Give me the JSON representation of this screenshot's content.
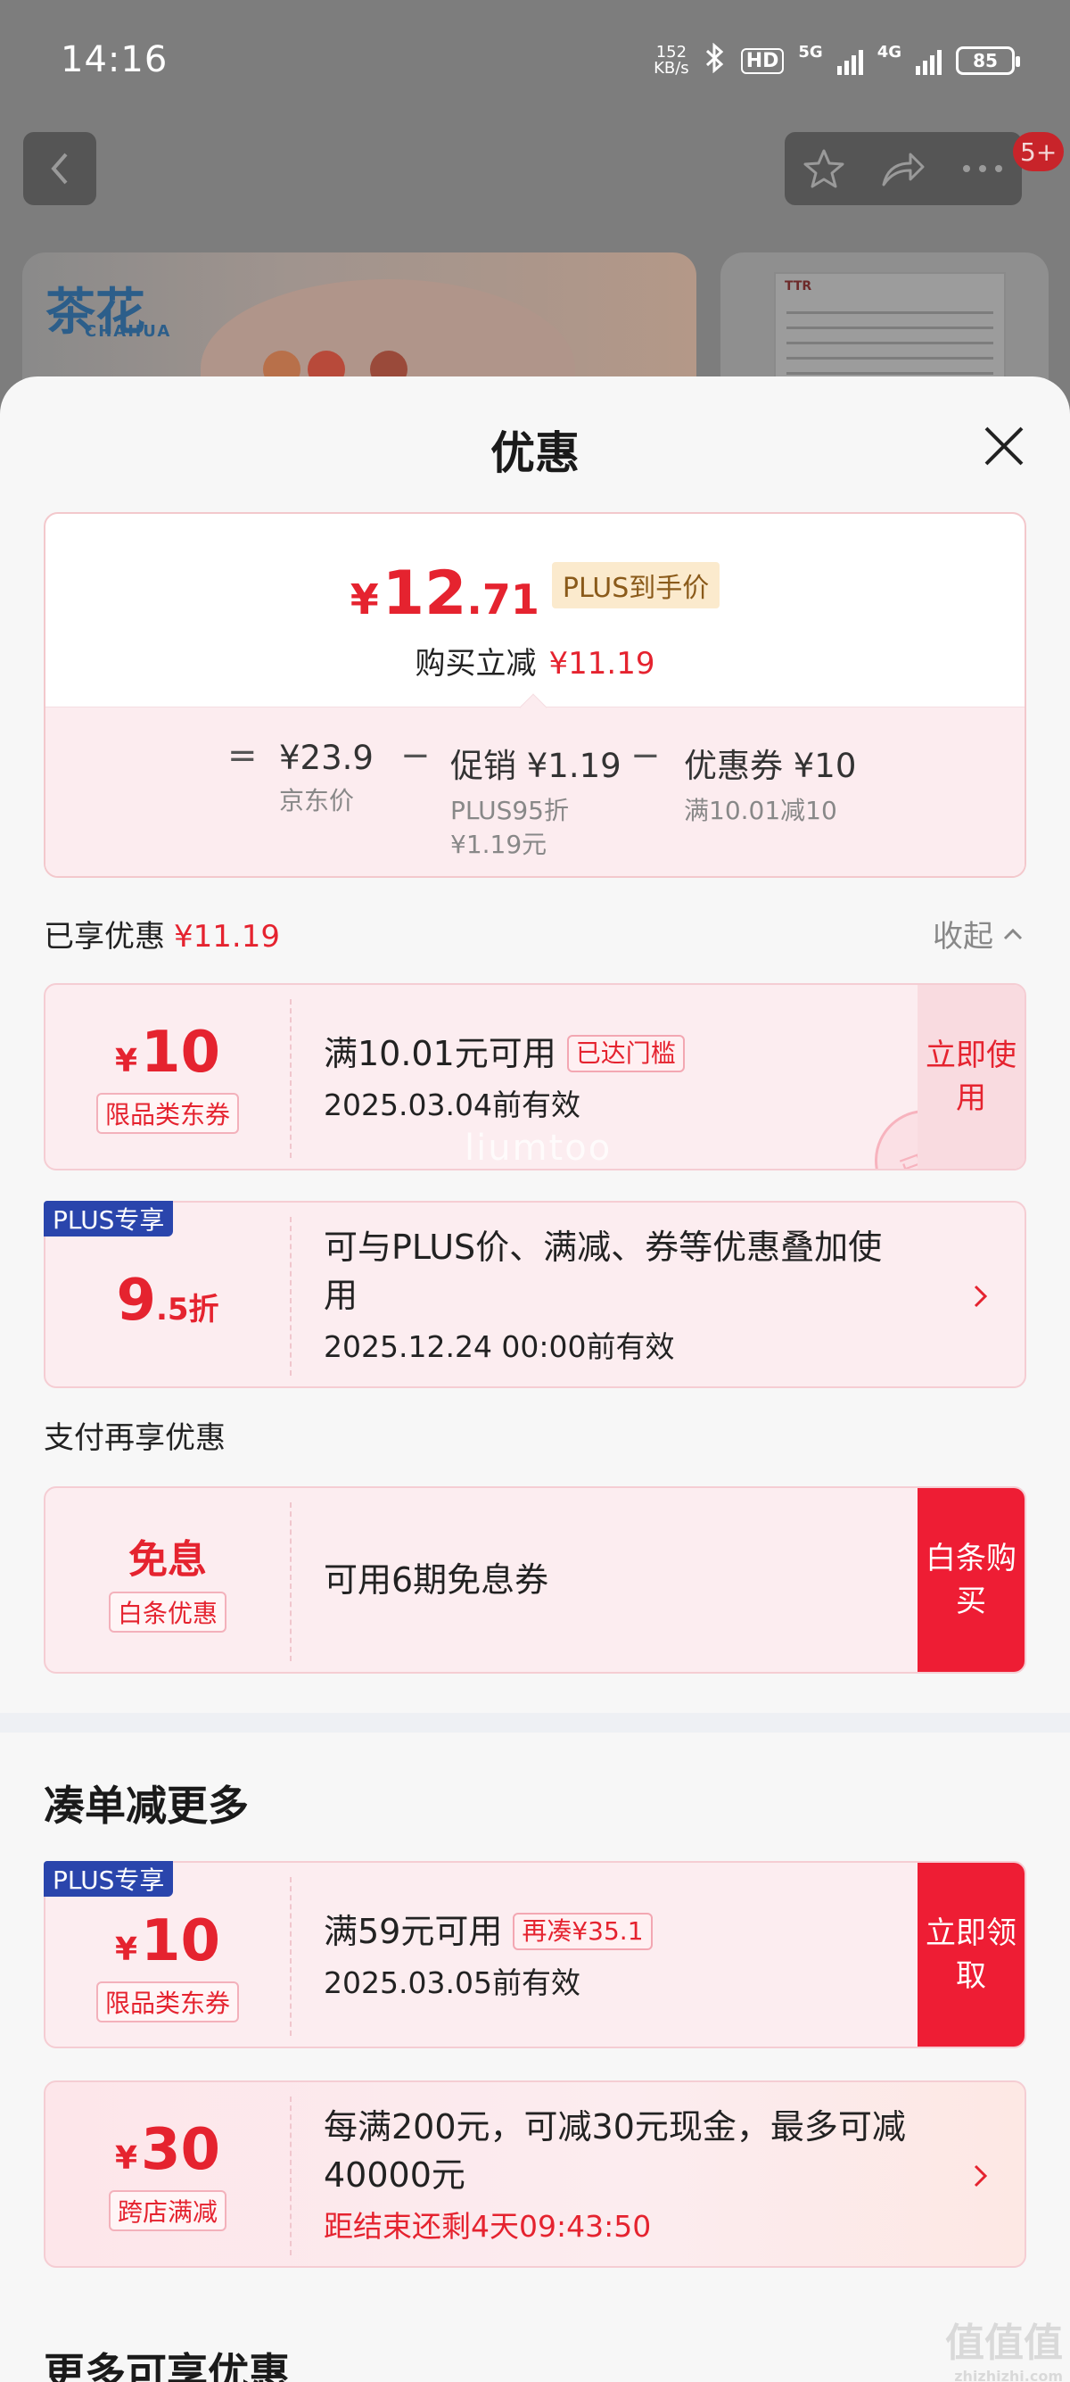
{
  "status_bar": {
    "time": "14:16",
    "speed_value": "152",
    "speed_unit": "KB/s",
    "hd": "HD",
    "net1": "5G",
    "net2": "4G",
    "battery": "85"
  },
  "header": {
    "badge": "5+",
    "icons": [
      "back-icon",
      "star-icon",
      "share-icon",
      "more-icon"
    ]
  },
  "banner": {
    "logo_cn": "茶花",
    "logo_en": "CHAHUA",
    "doc_label": "TTR"
  },
  "sheet": {
    "title": "优惠",
    "summary": {
      "currency": "¥",
      "price_int": "12",
      "price_dec": ".71",
      "plus_tag": "PLUS到手价",
      "instant_label": "购买立减",
      "instant_value": "¥11.19",
      "eq": "=",
      "minus": "−",
      "jd_price": "¥23.9",
      "jd_price_label": "京东价",
      "promo": "促销 ¥1.19",
      "promo_sub1": "PLUS95折",
      "promo_sub2": "¥1.19元",
      "coupon": "优惠券 ¥10",
      "coupon_sub": "满10.01减10"
    },
    "enjoyed_label": "已享优惠",
    "enjoyed_value": "¥11.19",
    "collapse_label": "收起",
    "cards": [
      {
        "currency": "¥",
        "amount": "10",
        "tag": "限品类东券",
        "line1": "满10.01元可用",
        "pill": "已达门槛",
        "line2": "2025.03.04前有效",
        "action": "立即使用",
        "stamp": "已领",
        "watermark": "liumtoo"
      },
      {
        "plus_badge": "PLUS专享",
        "amount": "9",
        "amount_suffix": ".5折",
        "line1": "可与PLUS价、满减、券等优惠叠加使",
        "line1b": "用",
        "line2": "2025.12.24 00:00前有效"
      }
    ],
    "pay_section": "支付再享优惠",
    "pay_card": {
      "title": "免息",
      "tag": "白条优惠",
      "line1": "可用6期免息券",
      "action": "白条购买"
    },
    "more_section": "凑单减更多",
    "more_cards": [
      {
        "plus_badge": "PLUS专享",
        "currency": "¥",
        "amount": "10",
        "tag": "限品类东券",
        "line1": "满59元可用",
        "pill": "再凑¥35.1",
        "line2": "2025.03.05前有效",
        "action": "立即领取"
      },
      {
        "currency": "¥",
        "amount": "30",
        "tag": "跨店满减",
        "line1": "每满200元，可减30元现金，最多可减",
        "line1b": "40000元",
        "countdown": "距结束还剩4天09:43:50"
      }
    ],
    "bottom_section": "更多可享优惠",
    "corner_watermark": "值值值",
    "corner_watermark_url": "zhizhizhi.com"
  }
}
